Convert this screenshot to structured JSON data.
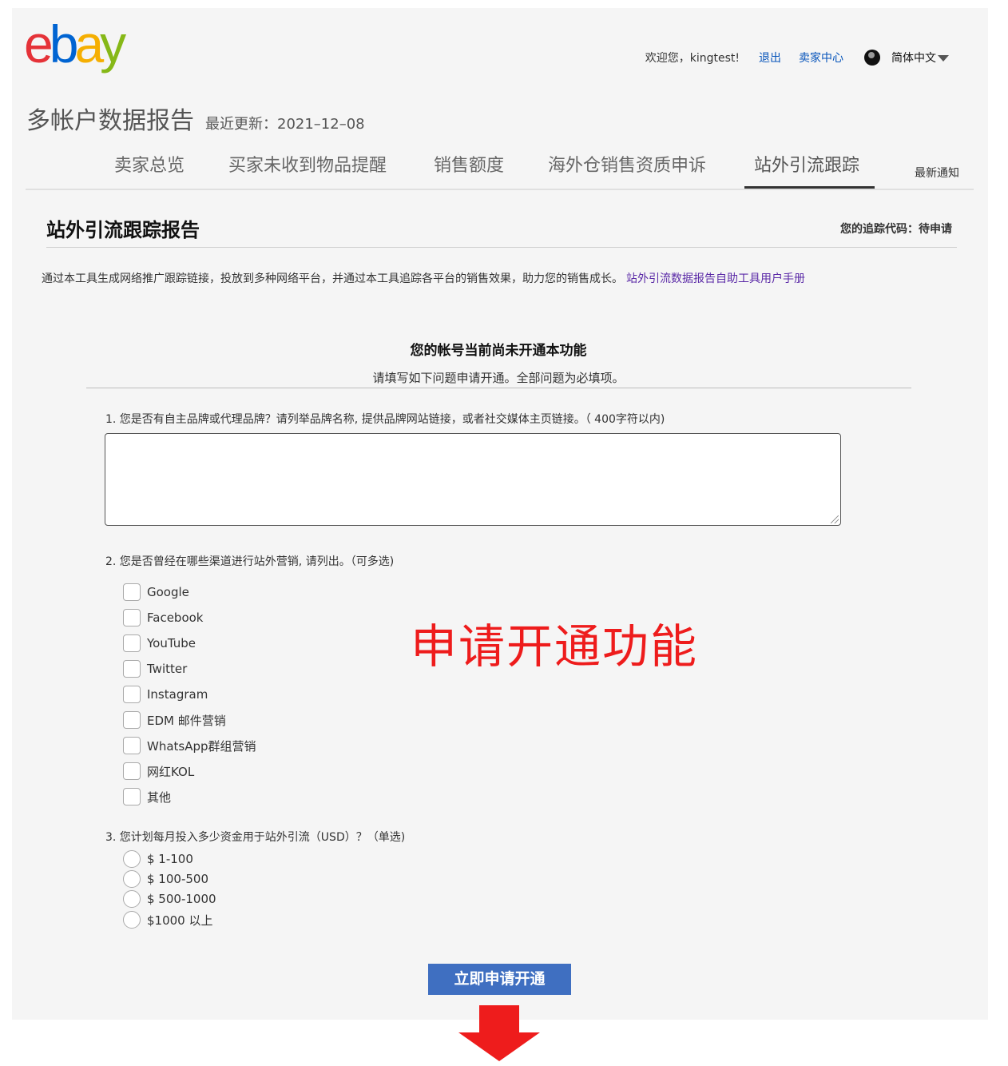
{
  "logo": {
    "e": "e",
    "b": "b",
    "a": "a",
    "y": "y"
  },
  "header": {
    "welcome": "欢迎您，kingtest!",
    "logout": "退出",
    "seller_center": "卖家中心",
    "language": "简体中文"
  },
  "report": {
    "title": "多帐户数据报告",
    "updated": "最近更新：2021–12–08"
  },
  "tabs": [
    {
      "label": "卖家总览"
    },
    {
      "label": "买家未收到物品提醒"
    },
    {
      "label": "销售额度"
    },
    {
      "label": "海外仓销售资质申诉"
    },
    {
      "label": "站外引流跟踪",
      "active": true
    }
  ],
  "latest_notice": "最新通知",
  "section": {
    "title": "站外引流跟踪报告",
    "tracking_code": "您的追踪代码：待申请"
  },
  "intro": {
    "text": "通过本工具生成网络推广跟踪链接，投放到多种网络平台，并通过本工具追踪各平台的销售效果，助力您的销售成长。",
    "manual_link": "站外引流数据报告自助工具用户手册"
  },
  "notice": {
    "title": "您的帐号当前尚未开通本功能",
    "subtitle": "请填写如下问题申请开通。全部问题为必填项。"
  },
  "form": {
    "q1": "1. 您是否有自主品牌或代理品牌？请列举品牌名称, 提供品牌网站链接，或者社交媒体主页链接。（ 400字符以内)",
    "q1_value": "",
    "q2": "2. 您是否曾经在哪些渠道进行站外营销, 请列出。（可多选)",
    "q2_options": [
      "Google",
      "Facebook",
      "YouTube",
      "Twitter",
      "Instagram",
      "EDM 邮件营销",
      "WhatsApp群组营销",
      "网红KOL",
      "其他"
    ],
    "q3": "3. 您计划每月投入多少资金用于站外引流（USD）？（单选)",
    "q3_options": [
      "$ 1-100",
      "$ 100-500",
      "$ 500-1000",
      "$1000 以上"
    ],
    "submit": "立即申请开通"
  },
  "annotation": {
    "text": "申请开通功能",
    "color": "#ee1c1c"
  },
  "colors": {
    "link": "#0654ba",
    "manual_link": "#5b2aa7",
    "button": "#3f6fc1",
    "arrow": "#ee1c1c"
  }
}
